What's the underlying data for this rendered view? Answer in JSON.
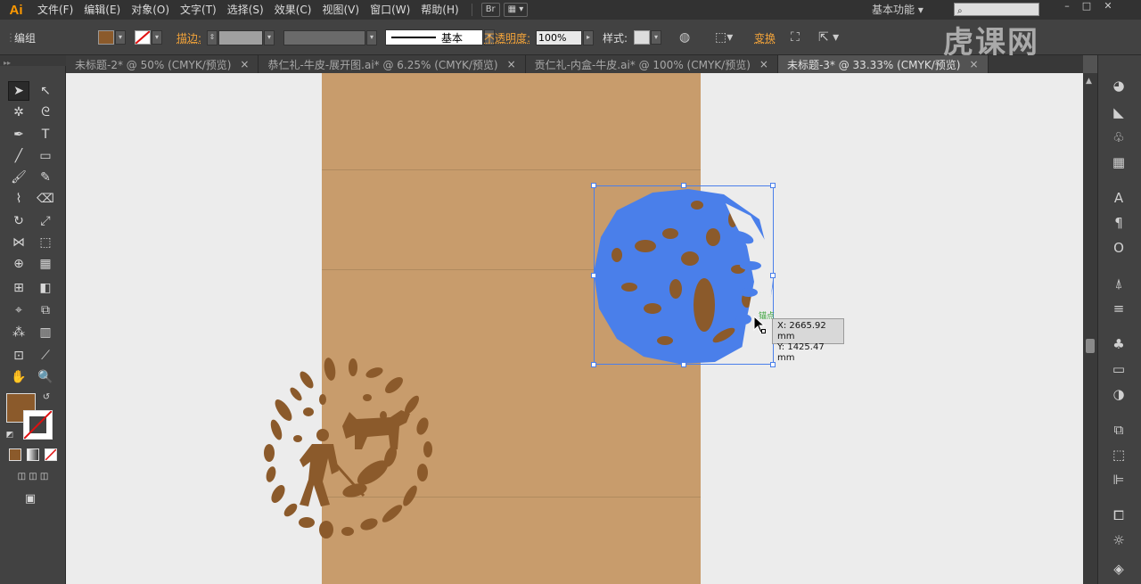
{
  "app": {
    "logo": "Ai"
  },
  "menu": {
    "items": [
      "文件(F)",
      "编辑(E)",
      "对象(O)",
      "文字(T)",
      "选择(S)",
      "效果(C)",
      "视图(V)",
      "窗口(W)",
      "帮助(H)"
    ],
    "bridge_label": "Br",
    "workspace": "基本功能",
    "search_placeholder": ""
  },
  "control": {
    "selection_type": "编组",
    "stroke_label": "描边:",
    "stroke_profile": "基本",
    "opacity_label": "不透明度:",
    "opacity_value": "100%",
    "style_label": "样式:",
    "transform_label": "变换",
    "fill_color": "#8b5a2b"
  },
  "tabs": [
    {
      "label": "未标题-2* @ 50% (CMYK/预览)"
    },
    {
      "label": "恭仁礼-牛皮-展开图.ai* @ 6.25% (CMYK/预览)"
    },
    {
      "label": "贡仁礼-内盒-牛皮.ai* @ 100% (CMYK/预览)"
    },
    {
      "label": "未标题-3* @ 33.33% (CMYK/预览)"
    }
  ],
  "tab_close_glyph": "×",
  "readout": {
    "x": "X: 2665.92 mm",
    "y": "Y: 1425.47 mm"
  },
  "snap_hint": "锚点",
  "watermark": "虎课网",
  "colors": {
    "artwork_brown": "#8b5a2b",
    "selection_blue": "#4a7fea",
    "kraft": "#c89c6c",
    "artboard_bg": "#ececec"
  }
}
